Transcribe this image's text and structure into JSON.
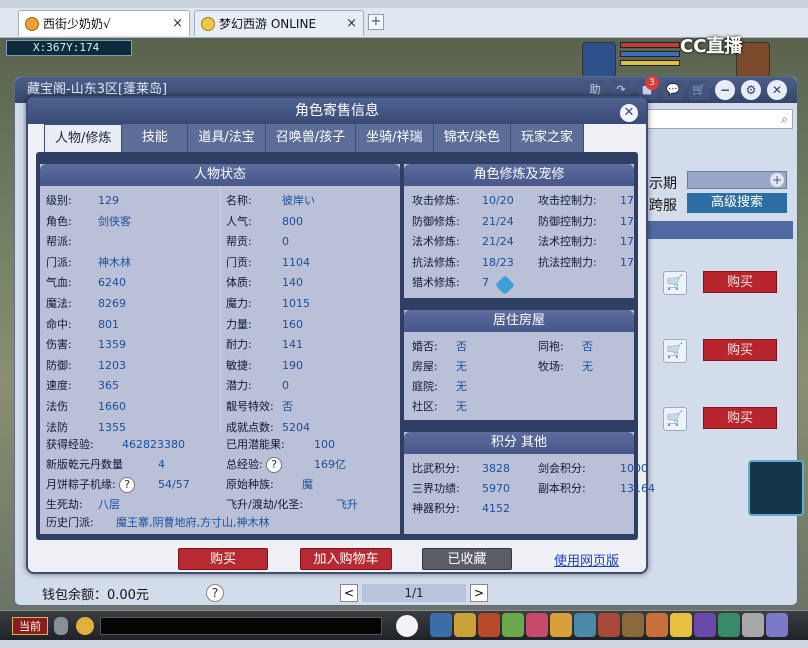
{
  "browser": {
    "tabs": [
      {
        "label": "西街少奶奶√",
        "close": "×"
      },
      {
        "label": "梦幻西游 ONLINE",
        "close": "×"
      }
    ],
    "new_tab": "+"
  },
  "game": {
    "coords": "X:367Y:174",
    "watermark": "CC直播",
    "current_channel": "当前"
  },
  "shop": {
    "title": "藏宝阁-山东3区[蓬莱岛]",
    "header_icons": [
      "助",
      "↷",
      "■",
      "💬",
      "🛒"
    ],
    "message_count": "3",
    "time_label": "示期",
    "cross_label": "跨服",
    "advanced_search": "高级搜索",
    "buy_label": "购买",
    "wallet": "钱包余额：0.00元",
    "wallet_help": "?",
    "page": "1/1",
    "prev": "<",
    "next": ">"
  },
  "dialog": {
    "title": "角色寄售信息",
    "close": "✕",
    "tabs": [
      "人物/修炼",
      "技能",
      "道具/法宝",
      "召唤兽/孩子",
      "坐骑/祥瑞",
      "锦衣/染色",
      "玩家之家"
    ],
    "active_tab": 0,
    "status_title": "人物状态",
    "status_left": [
      {
        "k": "级别:",
        "v": "129"
      },
      {
        "k": "角色:",
        "v": "剑侠客"
      },
      {
        "k": "帮派:",
        "v": ""
      },
      {
        "k": "门派:",
        "v": "神木林"
      },
      {
        "k": "气血:",
        "v": "6240"
      },
      {
        "k": "魔法:",
        "v": "8269"
      },
      {
        "k": "命中:",
        "v": "801"
      },
      {
        "k": "伤害:",
        "v": "1359"
      },
      {
        "k": "防御:",
        "v": "1203"
      },
      {
        "k": "速度:",
        "v": "365"
      },
      {
        "k": "法伤",
        "v": "1660"
      },
      {
        "k": "法防",
        "v": "1355"
      }
    ],
    "status_right": [
      {
        "k": "名称:",
        "v": "彼岸い"
      },
      {
        "k": "人气:",
        "v": "800"
      },
      {
        "k": "帮贡:",
        "v": "0"
      },
      {
        "k": "门贡:",
        "v": "1104"
      },
      {
        "k": "体质:",
        "v": "140"
      },
      {
        "k": "魔力:",
        "v": "1015"
      },
      {
        "k": "力量:",
        "v": "160"
      },
      {
        "k": "耐力:",
        "v": "141"
      },
      {
        "k": "敏捷:",
        "v": "190"
      },
      {
        "k": "潜力:",
        "v": "0"
      },
      {
        "k": "靓号特效:",
        "v": "否"
      },
      {
        "k": "成就点数:",
        "v": "5204"
      }
    ],
    "extra": {
      "exp_label": "获得经验:",
      "exp": "462823380",
      "used_pot_label": "已用潜能果:",
      "used_pot": "100",
      "qianyuan_label": "新版乾元丹数量",
      "qianyuan": "4",
      "total_exp_label": "总经验:",
      "total_exp": "169亿",
      "zongzi_label": "月饼粽子机缘:",
      "zongzi": "54/57",
      "race_label": "原始种族:",
      "race": "魔",
      "lifeskill_label": "生死劫:",
      "lifeskill": "八层",
      "fly_label": "飞升/渡劫/化圣:",
      "fly": "飞升",
      "history_label": "历史门派:",
      "history": "魔王寨,阴曹地府,方寸山,神木林",
      "help": "?"
    },
    "cultivation_title": "角色修炼及宠修",
    "cultivation": [
      {
        "k": "攻击修炼:",
        "v": "10/20",
        "k2": "攻击控制力:",
        "v2": "17"
      },
      {
        "k": "防御修炼:",
        "v": "21/24",
        "k2": "防御控制力:",
        "v2": "17"
      },
      {
        "k": "法术修炼:",
        "v": "21/24",
        "k2": "法术控制力:",
        "v2": "17"
      },
      {
        "k": "抗法修炼:",
        "v": "18/23",
        "k2": "抗法控制力:",
        "v2": "17"
      },
      {
        "k": "猎术修炼:",
        "v": "7",
        "k2": "",
        "v2": ""
      }
    ],
    "house_title": "居住房屋",
    "house": [
      {
        "k": "婚否:",
        "v": "否",
        "k2": "同袍:",
        "v2": "否"
      },
      {
        "k": "房屋:",
        "v": "无",
        "k2": "牧场:",
        "v2": "无"
      },
      {
        "k": "庭院:",
        "v": "无",
        "k2": "",
        "v2": ""
      },
      {
        "k": "社区:",
        "v": "无",
        "k2": "",
        "v2": ""
      }
    ],
    "score_title": "积分 其他",
    "score": [
      {
        "k": "比武积分:",
        "v": "3828",
        "k2": "剑会积分:",
        "v2": "1000"
      },
      {
        "k": "三界功绩:",
        "v": "5970",
        "k2": "副本积分:",
        "v2": "13164"
      },
      {
        "k": "神器积分:",
        "v": "4152",
        "k2": "",
        "v2": ""
      }
    ],
    "buttons": {
      "buy": "购买",
      "add_cart": "加入购物车",
      "favorited": "已收藏",
      "web_version": "使用网页版"
    }
  },
  "colors": {
    "accent": "#394a73",
    "buy": "#b82a31",
    "value": "#1a4f9a"
  }
}
